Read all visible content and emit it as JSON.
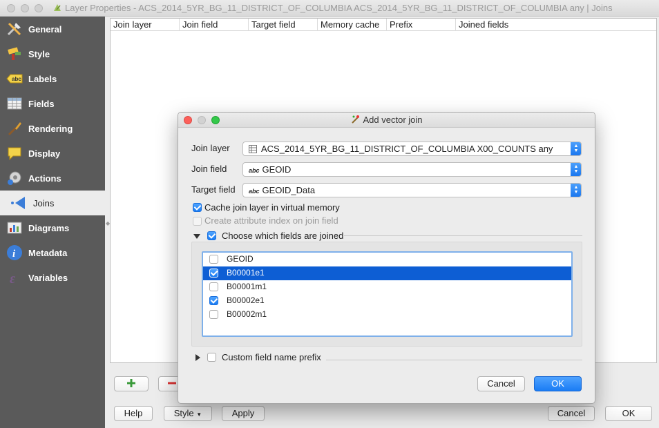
{
  "main_window": {
    "title": "Layer Properties - ACS_2014_5YR_BG_11_DISTRICT_OF_COLUMBIA ACS_2014_5YR_BG_11_DISTRICT_OF_COLUMBIA any | Joins"
  },
  "sidebar": {
    "items": [
      {
        "label": "General",
        "icon": "general-icon"
      },
      {
        "label": "Style",
        "icon": "style-icon"
      },
      {
        "label": "Labels",
        "icon": "labels-icon"
      },
      {
        "label": "Fields",
        "icon": "fields-icon"
      },
      {
        "label": "Rendering",
        "icon": "rendering-icon"
      },
      {
        "label": "Display",
        "icon": "display-icon"
      },
      {
        "label": "Actions",
        "icon": "actions-icon"
      },
      {
        "label": "Joins",
        "icon": "joins-icon",
        "active": true
      },
      {
        "label": "Diagrams",
        "icon": "diagrams-icon"
      },
      {
        "label": "Metadata",
        "icon": "metadata-icon"
      },
      {
        "label": "Variables",
        "icon": "variables-icon"
      }
    ]
  },
  "joins_table": {
    "columns": [
      "Join layer",
      "Join field",
      "Target field",
      "Memory cache",
      "Prefix",
      "Joined fields"
    ]
  },
  "bottom": {
    "help": "Help",
    "style": "Style",
    "apply": "Apply",
    "cancel": "Cancel",
    "ok": "OK"
  },
  "dialog": {
    "title": "Add vector join",
    "join_layer_label": "Join layer",
    "join_layer_value": "ACS_2014_5YR_BG_11_DISTRICT_OF_COLUMBIA X00_COUNTS any",
    "join_field_label": "Join field",
    "join_field_value": "GEOID",
    "target_field_label": "Target field",
    "target_field_value": "GEOID_Data",
    "field_type_badge": "abc",
    "cache_label": "Cache join layer in virtual memory",
    "cache_checked": true,
    "index_label": "Create attribute index on join field",
    "index_checked": false,
    "choose_fields_label": "Choose which fields are joined",
    "choose_fields_checked": true,
    "fields": [
      {
        "name": "GEOID",
        "checked": false,
        "selected": false
      },
      {
        "name": "B00001e1",
        "checked": true,
        "selected": true
      },
      {
        "name": "B00001m1",
        "checked": false,
        "selected": false
      },
      {
        "name": "B00002e1",
        "checked": true,
        "selected": false
      },
      {
        "name": "B00002m1",
        "checked": false,
        "selected": false
      }
    ],
    "prefix_label": "Custom field name prefix",
    "prefix_checked": false,
    "cancel": "Cancel",
    "ok": "OK"
  },
  "colors": {
    "sidebar_bg": "#5a5a5a",
    "accent": "#1a7cf4",
    "selection": "#0d5ed4"
  }
}
